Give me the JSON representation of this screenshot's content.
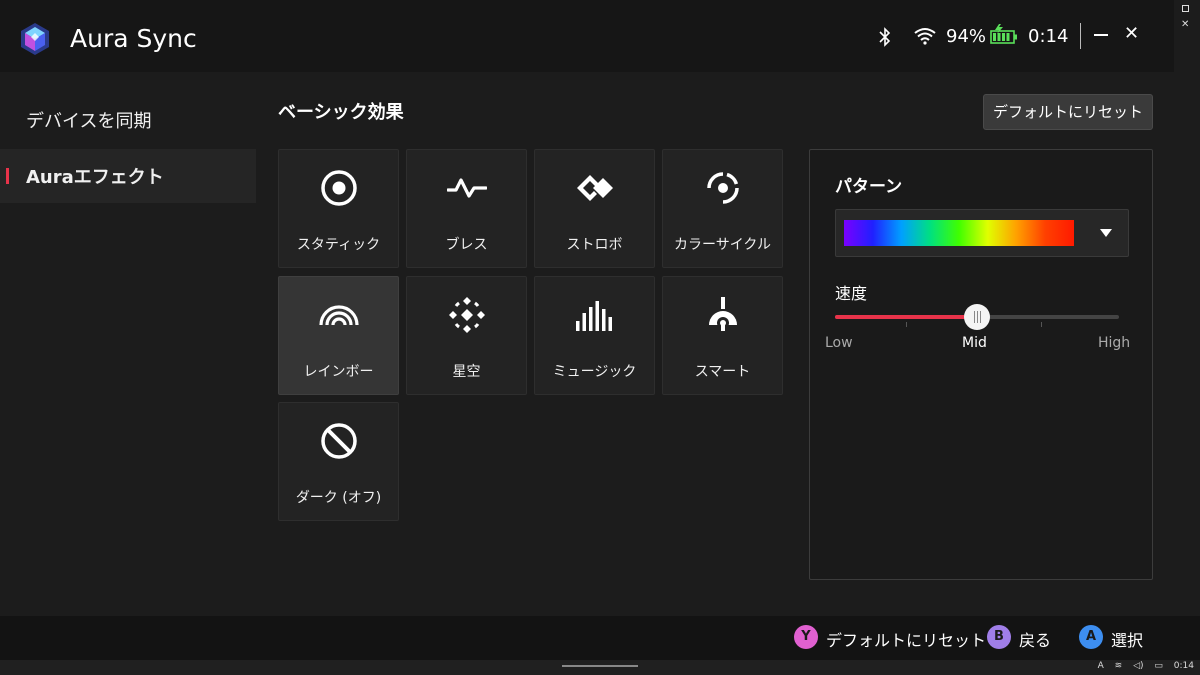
{
  "app": {
    "title": "Aura Sync"
  },
  "status": {
    "battery_pct": "94%",
    "clock": "0:14"
  },
  "sidebar": {
    "items": [
      {
        "label": "デバイスを同期"
      },
      {
        "label": "Auraエフェクト"
      }
    ]
  },
  "main": {
    "section_title": "ベーシック効果",
    "reset_label": "デフォルトにリセット",
    "effects": [
      {
        "label": "スタティック",
        "icon": "static-icon"
      },
      {
        "label": "ブレス",
        "icon": "breath-icon"
      },
      {
        "label": "ストロボ",
        "icon": "strobe-icon"
      },
      {
        "label": "カラーサイクル",
        "icon": "color-cycle-icon"
      },
      {
        "label": "レインボー",
        "icon": "rainbow-icon",
        "selected": true
      },
      {
        "label": "星空",
        "icon": "starry-night-icon"
      },
      {
        "label": "ミュージック",
        "icon": "music-icon"
      },
      {
        "label": "スマート",
        "icon": "smart-icon"
      },
      {
        "label": "ダーク (オフ)",
        "icon": "dark-off-icon"
      }
    ]
  },
  "panel": {
    "pattern_label": "パターン",
    "speed_label": "速度",
    "speed": {
      "min_label": "Low",
      "mid_label": "Mid",
      "max_label": "High",
      "value": 0.5
    },
    "accent_color": "#e8334a"
  },
  "footer": {
    "hints": [
      {
        "button": "Y",
        "label": "デフォルトにリセット",
        "color": "#e060d0"
      },
      {
        "button": "B",
        "label": "戻る",
        "color": "#a07ee8"
      },
      {
        "button": "A",
        "label": "選択",
        "color": "#3d8ef0"
      }
    ]
  },
  "taskbar": {
    "lang": "A",
    "clock": "0:14"
  }
}
